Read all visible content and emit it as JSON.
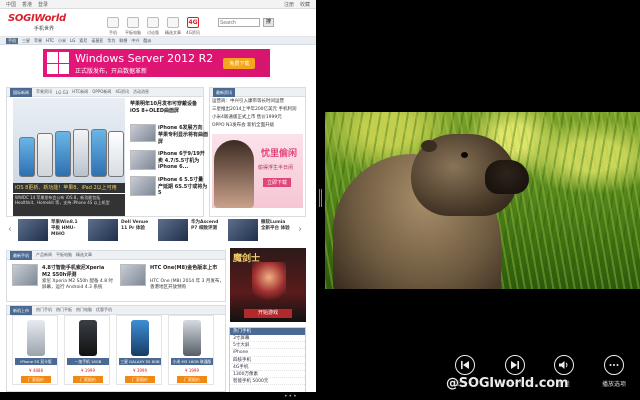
{
  "browser": {
    "topstrip": {
      "left": [
        "中国",
        "香港",
        "登录"
      ],
      "right": [
        "注册",
        "收藏"
      ]
    },
    "logo": {
      "word": "SOGIWorld",
      "sub": "手机世界"
    },
    "nav": [
      {
        "label": "手机",
        "icon": "phone-icon"
      },
      {
        "label": "平板电脑",
        "icon": "tablet-icon"
      },
      {
        "label": "讨论版",
        "icon": "forum-icon"
      },
      {
        "label": "精选文章",
        "icon": "article-icon"
      },
      {
        "label": "4G资讯",
        "icon": "4g-icon",
        "badge": "4G"
      }
    ],
    "search": {
      "placeholder": "Search",
      "button": "搜"
    },
    "linkrow": {
      "tag": "手机",
      "links": [
        "三星",
        "苹果",
        "HTC",
        "小米",
        "LG",
        "索尼",
        "诺基亚",
        "华为",
        "联想",
        "中兴",
        "酷派"
      ]
    },
    "banner": {
      "title": "Windows Server 2012 R2",
      "subtitle": "正式版发布，开启数据革新",
      "cta": "免费下载"
    },
    "tabs_top": [
      "国际新闻",
      "苹果资讯",
      "LG G3",
      "HTC新闻",
      "OPPO新闻",
      "4G资讯",
      "活动消息"
    ],
    "tabs_right": [
      "最新资讯"
    ],
    "hero": {
      "caption": "iOS 8更新、新功能！苹果8、iPad 2以上可用",
      "desc": "WWDC 14 苹果发布会公布 iOS 8，新功能包括 Healthkit、Homekit 等，支持 iPhone 4S 以上机型"
    },
    "news_center": [
      {
        "text": "苹果明年10月发布可穿戴设备 iOS 8+OLED曲面屏",
        "bold": true
      },
      {
        "text": "iPhone 6发展方向 苹果专利显示将有曲面屏",
        "bold": true
      },
      {
        "text": "iPhone 6于9/19开卖 4.7/5.5寸机为 iPhone 6...",
        "bold": true
      },
      {
        "text": "iPhone 6 5.5寸量产延期 6S.5寸或将为5",
        "bold": true
      }
    ],
    "news_right": [
      "运营商：中兴引入康带等长时间运营",
      "三星推出2014上半年200亿美元 手机利润",
      "小米4联通版正式上市 售价1999元",
      "OPPO N3发布会 新机全面升级"
    ],
    "ad_right": {
      "title": "忧里偷闲",
      "sub": "偷得浮生半日闲",
      "cta": "立即下载"
    },
    "carousel": [
      "苹果Win8.1平板 HMU-MIHO",
      "Dell Venue 11 Pr 体验",
      "华为Ascend P7 细致评测",
      "微软Lumia 全新平台 体验"
    ],
    "tabs_mid": [
      "最新手机",
      "产品新闻",
      "平板电脑",
      "精选文章"
    ],
    "news_mid": [
      {
        "text": "4.8寸智能手机索尼Xperia M2 S50h评测",
        "bold": true
      },
      {
        "text": "索尼 Xperia M2 S50h 配备 4.8 吋屏幕，运行 Android 4.3 系统",
        "bold": false
      },
      {
        "text": "HTC One(M8)金色版本上市",
        "bold": true
      },
      {
        "text": "HTC One (M8) 2014 年 3 月发布，香港地区开放预购",
        "bold": false
      }
    ],
    "game": {
      "title": "魔剑士",
      "cta": "开始游戏"
    },
    "tabs_bottom": [
      "新机上市",
      "热门手机",
      "热门平板",
      "热门电脑",
      "优惠手机"
    ],
    "products": [
      {
        "name": "iPhone 5S 双卡版",
        "price": "¥ 4888"
      },
      {
        "name": "一加手机 16GB",
        "price": "¥ 1999"
      },
      {
        "name": "三星 GALAXY S5 8GB",
        "price": "¥ 3999"
      },
      {
        "name": "小米 M3 16GB 联通版",
        "price": "¥ 1999"
      }
    ],
    "product_button": "厂家报价",
    "sidemenu": {
      "title": "热门手机",
      "items": [
        "3寸屏幕",
        "5寸大屏",
        "iPhone",
        "四核手机",
        "4G手机",
        "1300万像素",
        "智能手机 5000元"
      ]
    }
  },
  "player": {
    "controls": [
      {
        "label": "上一个",
        "icon": "previous-track-icon"
      },
      {
        "label": "下一个",
        "icon": "next-track-icon"
      },
      {
        "label": "音量",
        "icon": "volume-icon"
      },
      {
        "label": "播放选项",
        "icon": "more-options-icon"
      }
    ],
    "watermark": "@SOGIworld.com"
  },
  "colors": {
    "accent": "#4a6a93",
    "brand": "#d8202a",
    "banner": "#e6157b"
  }
}
